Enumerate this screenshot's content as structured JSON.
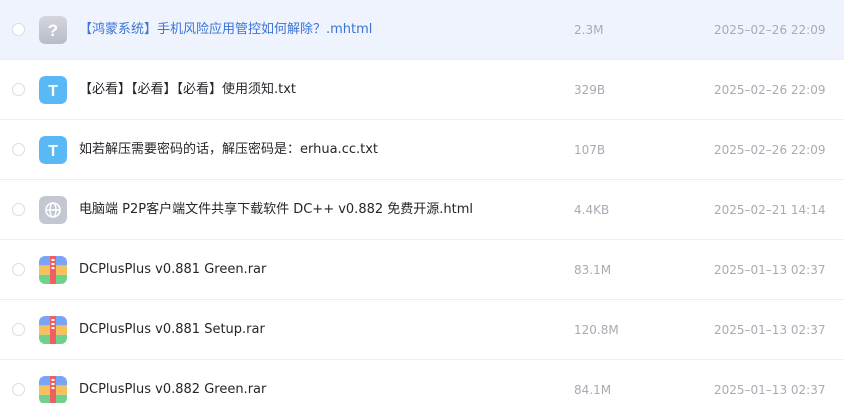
{
  "files": [
    {
      "name": "【鸿蒙系统】手机风险应用管控如何解除？.mhtml",
      "size": "2.3M",
      "modified": "2025–02–26 22:09",
      "icon": "unknown-file-icon"
    },
    {
      "name": "【必看】【必看】【必看】使用须知.txt",
      "size": "329B",
      "modified": "2025–02–26 22:09",
      "icon": "text-file-icon",
      "icon_letter": "T"
    },
    {
      "name": "如若解压需要密码的话，解压密码是：erhua.cc.txt",
      "size": "107B",
      "modified": "2025–02–26 22:09",
      "icon": "text-file-icon",
      "icon_letter": "T"
    },
    {
      "name": "电脑端 P2P客户端文件共享下载软件 DC++ v0.882 免费开源.html",
      "size": "4.4KB",
      "modified": "2025–02–21 14:14",
      "icon": "web-file-icon"
    },
    {
      "name": "DCPlusPlus v0.881 Green.rar",
      "size": "83.1M",
      "modified": "2025–01–13 02:37",
      "icon": "archive-file-icon"
    },
    {
      "name": "DCPlusPlus v0.881 Setup.rar",
      "size": "120.8M",
      "modified": "2025–01–13 02:37",
      "icon": "archive-file-icon"
    },
    {
      "name": "DCPlusPlus v0.882 Green.rar",
      "size": "84.1M",
      "modified": "2025–01–13 02:37",
      "icon": "archive-file-icon"
    }
  ],
  "colors": {
    "active_row_bg": "#eef3fe",
    "active_text": "#3b74d6",
    "text_icon_bg": "#5ab8f5",
    "unknown_icon_bg": "#c3c7d1"
  }
}
